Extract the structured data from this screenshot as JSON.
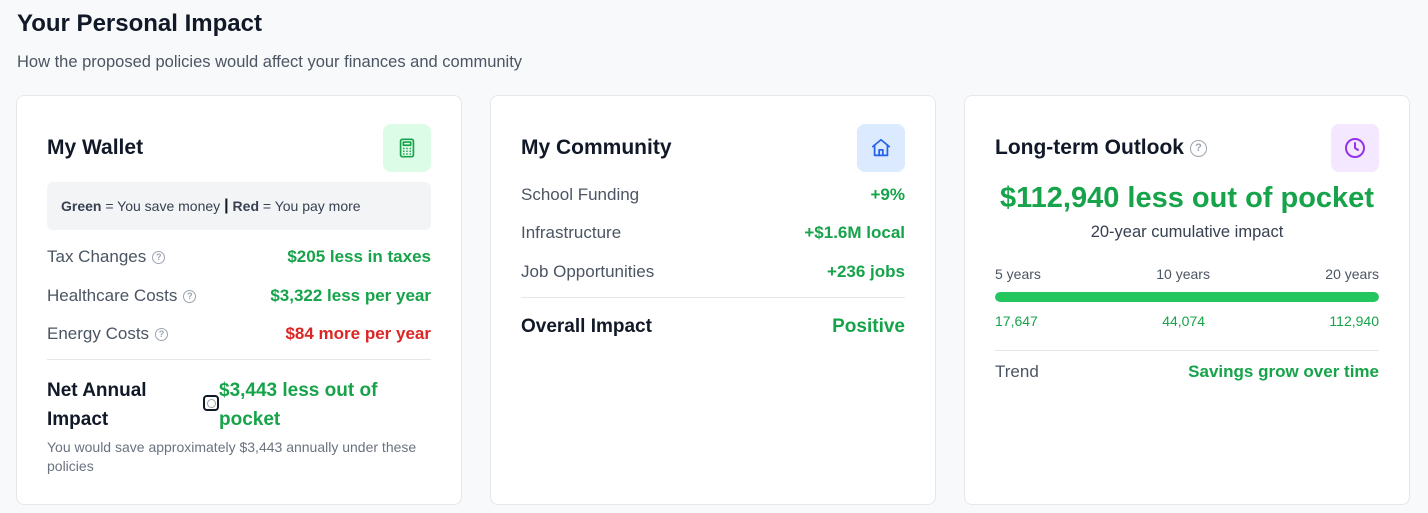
{
  "page": {
    "title": "Your Personal Impact",
    "subtitle": "How the proposed policies would affect your finances and community"
  },
  "wallet": {
    "title": "My Wallet",
    "icon": "calculator-icon",
    "legend": {
      "green_word": "Green",
      "green_text": " = You save money ",
      "separator": "|",
      "red_word": "Red",
      "red_text": " = You pay more"
    },
    "rows": [
      {
        "label": "Tax Changes",
        "value": "$205 less in taxes",
        "tone": "green"
      },
      {
        "label": "Healthcare Costs",
        "value": "$3,322 less per year",
        "tone": "green"
      },
      {
        "label": "Energy Costs",
        "value": "$84 more per year",
        "tone": "red"
      }
    ],
    "net": {
      "label": "Net Annual Impact",
      "value": "$3,443 less out of pocket",
      "note": "You would save approximately $3,443 annually under these policies"
    }
  },
  "community": {
    "title": "My Community",
    "icon": "home-icon",
    "rows": [
      {
        "label": "School Funding",
        "value": "+9%"
      },
      {
        "label": "Infrastructure",
        "value": "+$1.6M local"
      },
      {
        "label": "Job Opportunities",
        "value": "+236 jobs"
      }
    ],
    "overall": {
      "label": "Overall Impact",
      "value": "Positive"
    }
  },
  "outlook": {
    "title": "Long-term Outlook",
    "icon": "clock-icon",
    "total": "$112,940 less out of pocket",
    "total_sub": "20-year cumulative impact",
    "milestones": [
      "5 years",
      "10 years",
      "20 years"
    ],
    "amounts": [
      "17,647",
      "44,074",
      "112,940"
    ],
    "progress_fraction": 1.0,
    "trend": {
      "label": "Trend",
      "value": "Savings grow over time"
    }
  },
  "colors": {
    "positive": "#16a34a",
    "negative": "#dc2626",
    "bar": "#22c55e"
  }
}
